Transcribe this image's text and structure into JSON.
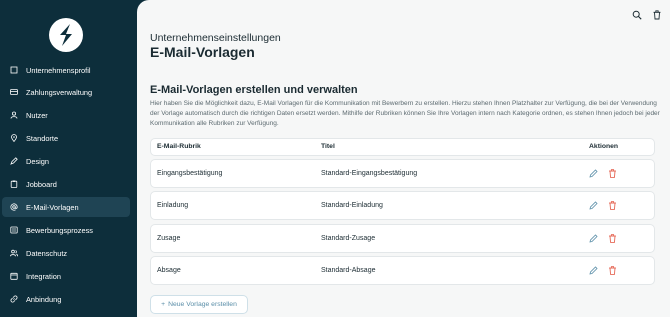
{
  "sidebar": {
    "items": [
      {
        "label": "Unternehmensprofil",
        "icon": "building-icon"
      },
      {
        "label": "Zahlungsverwaltung",
        "icon": "credit-card-icon"
      },
      {
        "label": "Nutzer",
        "icon": "user-icon"
      },
      {
        "label": "Standorte",
        "icon": "location-pin-icon"
      },
      {
        "label": "Design",
        "icon": "pen-icon"
      },
      {
        "label": "Jobboard",
        "icon": "clipboard-icon"
      },
      {
        "label": "E-Mail-Vorlagen",
        "icon": "at-sign-icon",
        "active": true
      },
      {
        "label": "Bewerbungsprozess",
        "icon": "list-icon"
      },
      {
        "label": "Datenschutz",
        "icon": "users-icon"
      },
      {
        "label": "Integration",
        "icon": "calendar-icon"
      },
      {
        "label": "Anbindung",
        "icon": "link-icon"
      }
    ]
  },
  "header": {
    "kicker": "Unternehmenseinstellungen",
    "title": "E-Mail-Vorlagen"
  },
  "section": {
    "title": "E-Mail-Vorlagen erstellen und verwalten",
    "description": "Hier haben Sie die Möglichkeit dazu, E-Mail Vorlagen für die Kommunikation mit Bewerbern zu erstellen. Hierzu stehen Ihnen Platzhalter zur Verfügung, die bei der Verwendung der Vorlage automatisch durch die richtigen Daten ersetzt werden. Mithilfe der Rubriken können Sie Ihre Vorlagen intern nach Kategorie ordnen, es stehen Ihnen jedoch bei jeder Kommunikation alle Rubriken zur Verfügung."
  },
  "table": {
    "columns": [
      "E-Mail-Rubrik",
      "Titel",
      "Aktionen"
    ],
    "rows": [
      {
        "rubrik": "Eingangsbestätigung",
        "titel": "Standard-Eingangsbestätigung"
      },
      {
        "rubrik": "Einladung",
        "titel": "Standard-Einladung"
      },
      {
        "rubrik": "Zusage",
        "titel": "Standard-Zusage"
      },
      {
        "rubrik": "Absage",
        "titel": "Standard-Absage"
      }
    ]
  },
  "new_button": {
    "label": "Neue Vorlage erstellen",
    "icon": "plus-icon"
  },
  "top_bar": {
    "icons": [
      "search-icon",
      "trash-icon"
    ]
  },
  "colors": {
    "sidebar": "#0d2e3b",
    "active_item": "#1f4454",
    "edit": "#5a8ea8",
    "delete": "#e2533f"
  }
}
